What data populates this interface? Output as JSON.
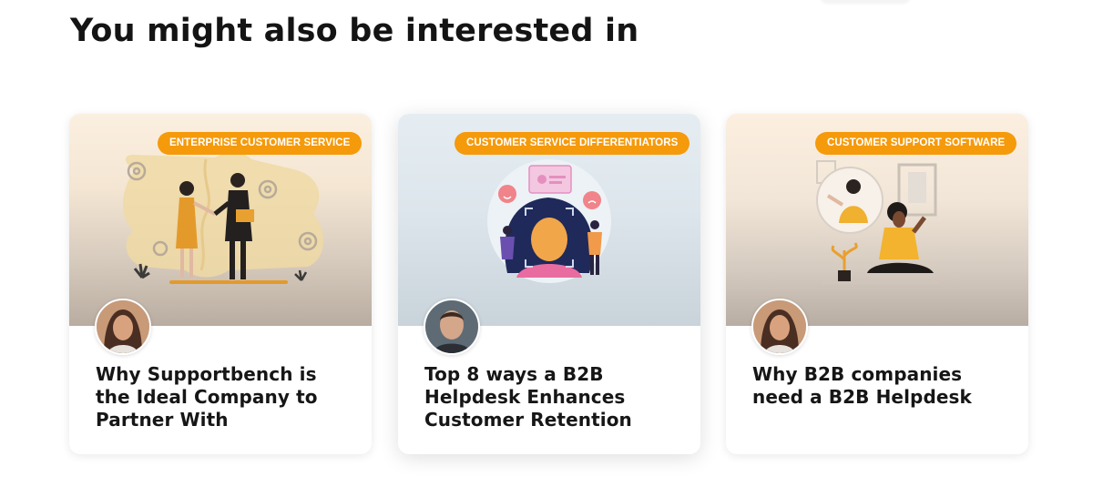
{
  "section": {
    "title": "You might also be interested in"
  },
  "cards": [
    {
      "tag": "ENTERPRISE CUSTOMER SERVICE",
      "title": "Why Supportbench is the Ideal Company to Partner With",
      "illustration": "handshake-puzzle-illustration",
      "author_avatar": "woman-author-avatar"
    },
    {
      "tag": "CUSTOMER SERVICE DIFFERENTIATORS",
      "title": "Top 8 ways a B2B Helpdesk Enhances Customer Retention",
      "illustration": "face-scan-feedback-illustration",
      "author_avatar": "man-author-avatar"
    },
    {
      "tag": "CUSTOMER SUPPORT SOFTWARE",
      "title": "Why B2B companies need a B2B Helpdesk",
      "illustration": "video-call-illustration",
      "author_avatar": "woman-author-avatar"
    }
  ],
  "colors": {
    "accent": "#f59a0b",
    "title_text": "#141414",
    "card_background": "#ffffff"
  }
}
